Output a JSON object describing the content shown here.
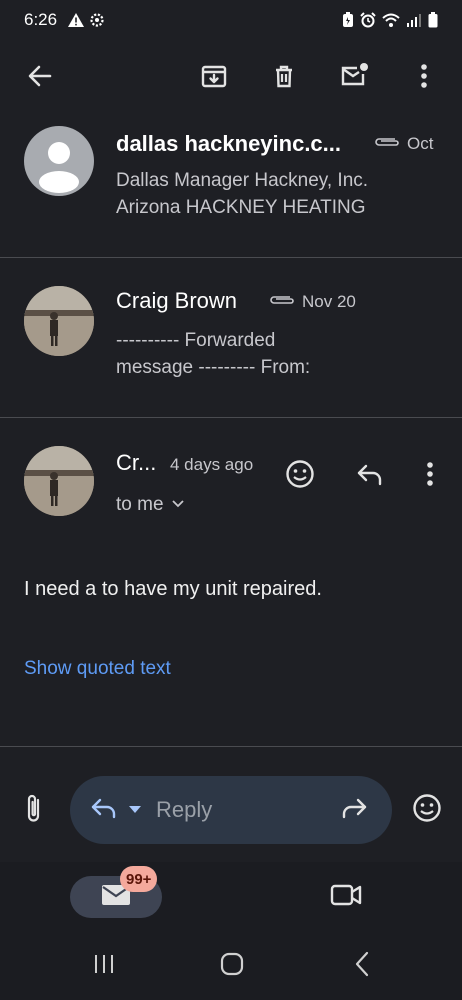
{
  "status_bar": {
    "time": "6:26",
    "icons": [
      "alert-triangle-icon",
      "settings-gear-icon",
      "battery-saver-icon",
      "alarm-icon",
      "wifi-icon",
      "signal-icon",
      "battery-icon"
    ]
  },
  "app_bar": {
    "icons": [
      "back-arrow-icon",
      "archive-icon",
      "delete-icon",
      "mark-unread-icon",
      "more-vert-icon"
    ]
  },
  "messages": [
    {
      "sender": "dallas hackneyinc.c...",
      "date": "Oct",
      "has_attachment": true,
      "snippet_line1": "Dallas Manager Hackney, Inc.",
      "snippet_line2": "Arizona HACKNEY HEATING"
    },
    {
      "sender": "Craig Brown",
      "date": "Nov 20",
      "has_attachment": true,
      "snippet_line1": "---------- Forwarded",
      "snippet_line2": "message --------- From:"
    },
    {
      "sender": "Cr...",
      "date": "4 days ago",
      "recipient": "to me",
      "body": "I need a to have my unit repaired.",
      "show_quoted": "Show quoted text"
    }
  ],
  "reply_bar": {
    "placeholder": "Reply"
  },
  "bottom_nav": {
    "badge": "99+"
  },
  "colors": {
    "background": "#1e1f24",
    "link": "#5e9bf5",
    "badge_bg": "#f4a99c",
    "reply_pill": "#2d3746"
  }
}
